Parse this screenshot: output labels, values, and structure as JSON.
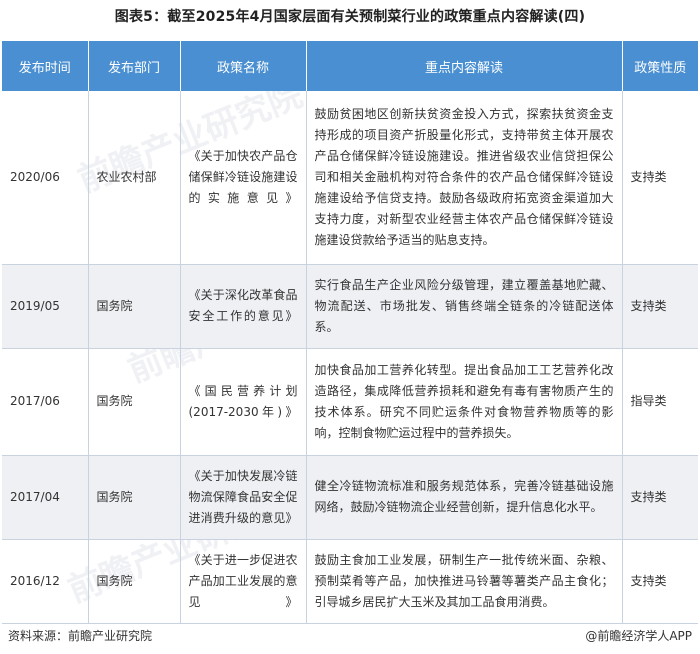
{
  "title": "图表5：截至2025年4月国家层面有关预制菜行业的政策重点内容解读(四)",
  "columns": [
    "发布时间",
    "发布部门",
    "政策名称",
    "重点内容解读",
    "政策性质"
  ],
  "rows": [
    {
      "date": "2020/06",
      "dept": "农业农村部",
      "name": "《关于加快农产品仓储保鲜冷链设施建设的实施意见》",
      "content": "鼓励贫困地区创新扶贫资金投入方式，探索扶贫资金支持形成的项目资产折股量化形式，支持带贫主体开展农产品仓储保鲜冷链设施建设。推进省级农业信贷担保公司和相关金融机构对符合条件的农产品仓储保鲜冷链设施建设给予信贷支持。鼓励各级政府拓宽资金渠道加大支持力度，对新型农业经营主体农产品仓储保鲜冷链设施建设贷款给予适当的贴息支持。",
      "nature": "支持类"
    },
    {
      "date": "2019/05",
      "dept": "国务院",
      "name": "《关于深化改革食品安全工作的意见》",
      "content": "实行食品生产企业风险分级管理，建立覆盖基地贮藏、物流配送、市场批发、销售终端全链条的冷链配送体系。",
      "nature": "支持类"
    },
    {
      "date": "2017/06",
      "dept": "国务院",
      "name": "《国民营养计划(2017-2030年)》",
      "content": "加快食品加工营养化转型。提出食品加工工艺营养化改造路径，集成降低营养损耗和避免有毒有害物质产生的技术体系。研究不同贮运条件对食物营养物质等的影响，控制食物贮运过程中的营养损失。",
      "nature": "指导类"
    },
    {
      "date": "2017/04",
      "dept": "国务院",
      "name": "《关于加快发展冷链物流保障食品安全促进消费升级的意见》",
      "content": "健全冷链物流标准和服务规范体系，完善冷链基础设施网络，鼓励冷链物流企业经营创新，提升信息化水平。",
      "nature": "支持类"
    },
    {
      "date": "2016/12",
      "dept": "国务院",
      "name": "《关于进一步促进农产品加工业发展的意见》",
      "content": "鼓励主食加工业发展，研制生产一批传统米面、杂粮、预制菜肴等产品，加快推进马铃薯等薯类产品主食化；引导城乡居民扩大玉米及其加工品食用消费。",
      "nature": "支持类"
    }
  ],
  "footer": {
    "source": "资料来源：前瞻产业研究院",
    "brand": "@前瞻经济学人APP"
  },
  "colors": {
    "header_bg": "#4a8fd1",
    "row_alt_bg": "#eef0f3"
  }
}
